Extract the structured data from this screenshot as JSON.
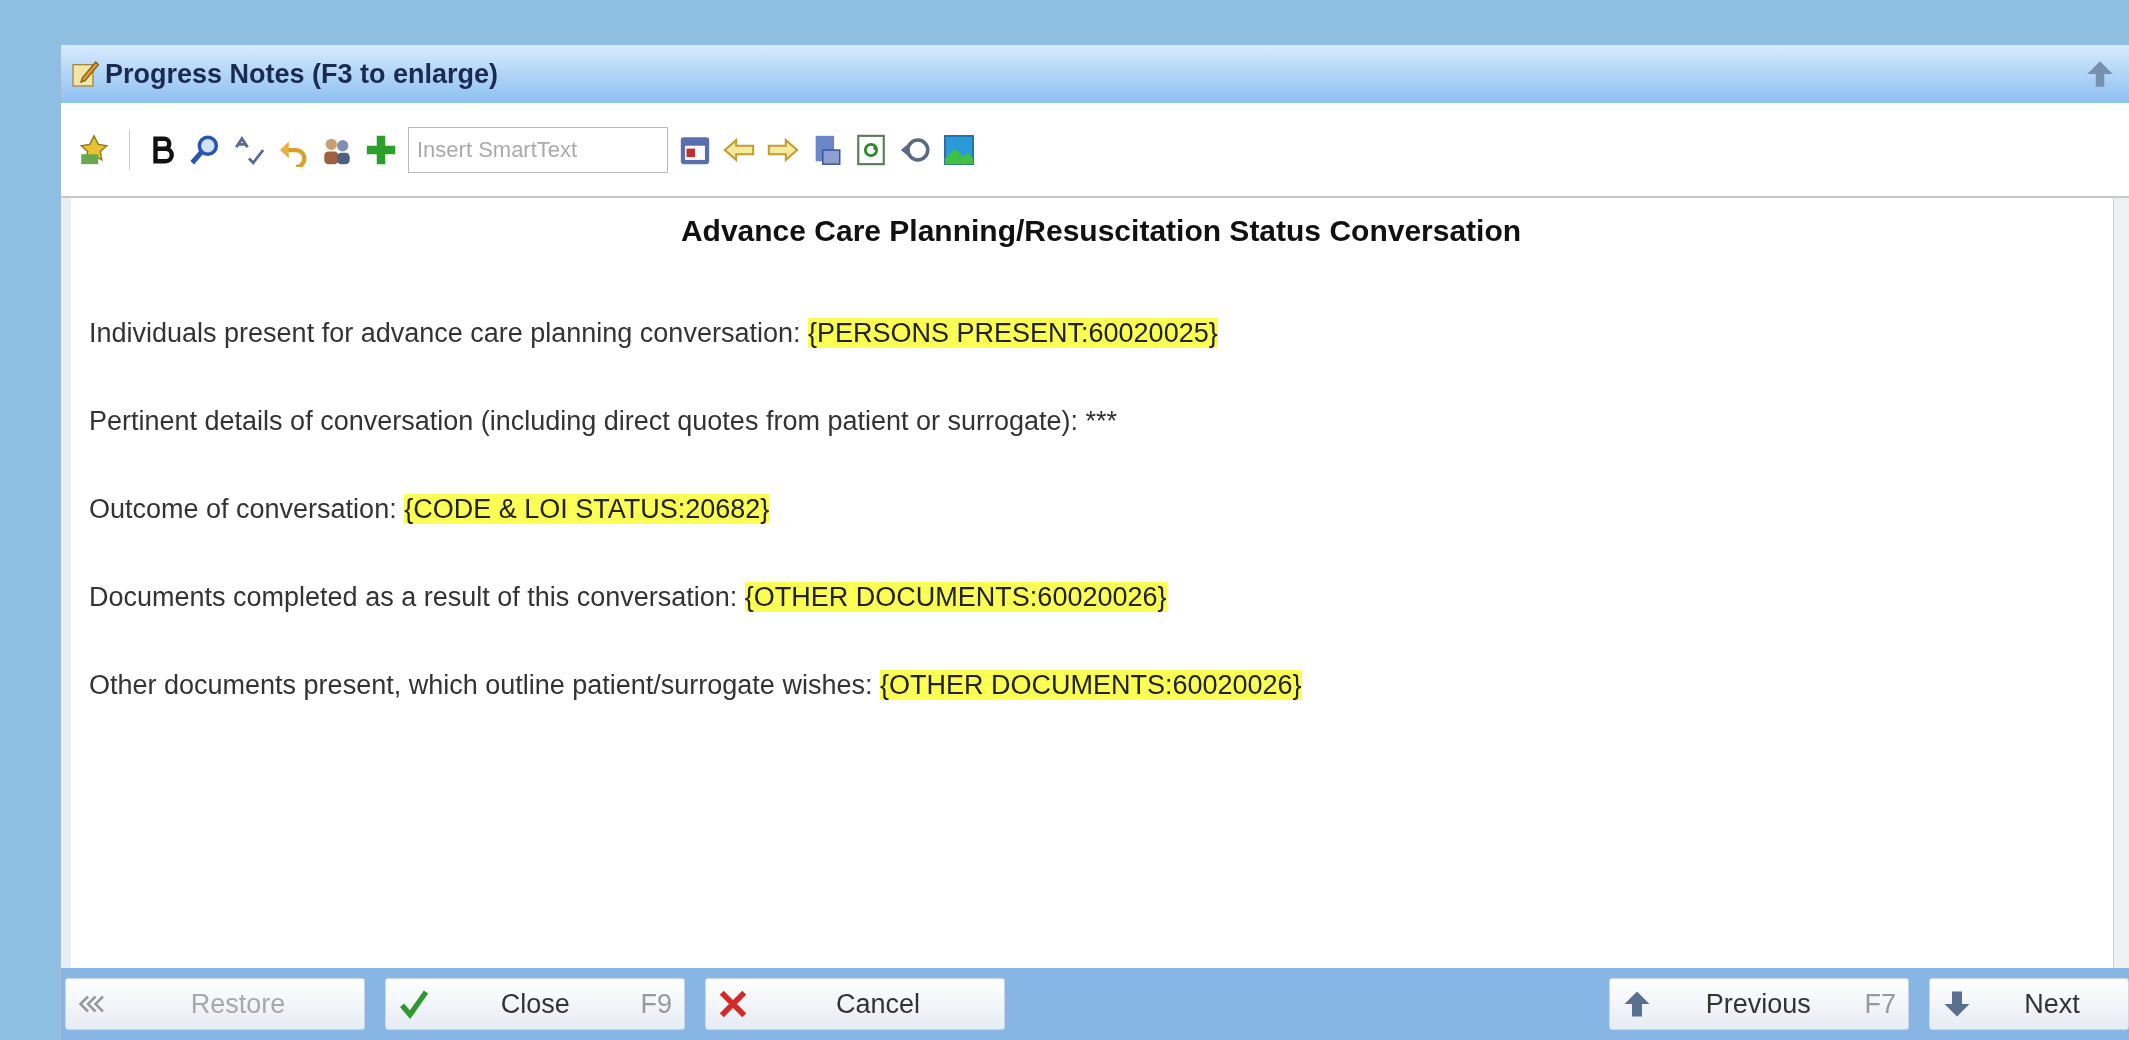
{
  "window": {
    "title": "Progress Notes (F3 to enlarge)"
  },
  "toolbar": {
    "smarttext": {
      "placeholder": "Insert SmartText"
    }
  },
  "note": {
    "heading": "Advance Care Planning/Resuscitation Status Conversation",
    "lines": [
      {
        "text": "Individuals present for advance care planning conversation:",
        "field": "{PERSONS PRESENT:60020025}"
      },
      {
        "text": "Pertinent details of conversation (including direct quotes from patient or surrogate): ***"
      },
      {
        "text": "Outcome of conversation:",
        "field": "{CODE & LOI STATUS:20682}"
      },
      {
        "text": "Documents completed as a result of this conversation:",
        "field": "{OTHER DOCUMENTS:60020026}"
      },
      {
        "text": "Other documents present, which outline patient/surrogate wishes:",
        "field": "{OTHER DOCUMENTS:60020026}"
      }
    ]
  },
  "buttons_left": [
    {
      "label": "Restore",
      "disabled": true
    },
    {
      "label": "Close",
      "shortcut": "F9",
      "disabled": false
    },
    {
      "label": "Cancel",
      "disabled": false
    }
  ],
  "buttons_right": [
    {
      "label": "Previous",
      "shortcut": "F7",
      "disabled": false
    },
    {
      "label": "Next",
      "disabled": false
    }
  ]
}
